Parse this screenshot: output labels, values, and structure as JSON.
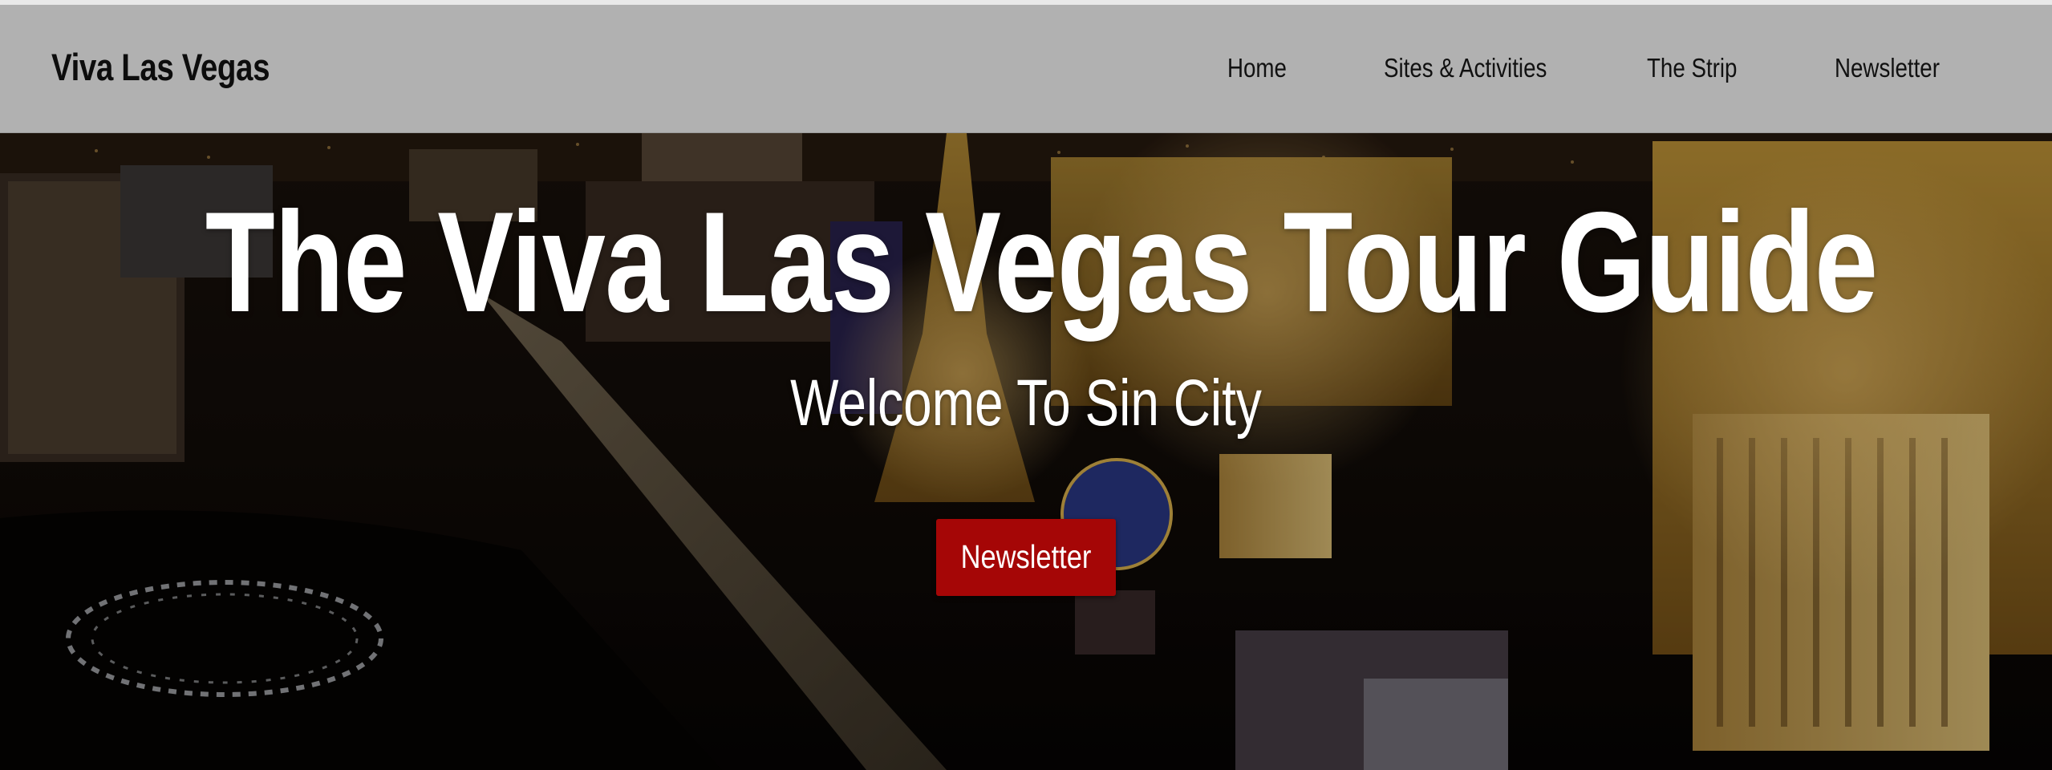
{
  "header": {
    "brand": "Viva Las Vegas",
    "nav": [
      {
        "label": "Home"
      },
      {
        "label": "Sites & Activities"
      },
      {
        "label": "The Strip"
      },
      {
        "label": "Newsletter"
      }
    ]
  },
  "hero": {
    "title": "The Viva Las Vegas Tour Guide",
    "subtitle": "Welcome To Sin City",
    "button_label": "Newsletter"
  },
  "colors": {
    "navbar_bg": "#b1b1b1",
    "button_bg": "#a50606",
    "hero_text": "#ffffff"
  }
}
